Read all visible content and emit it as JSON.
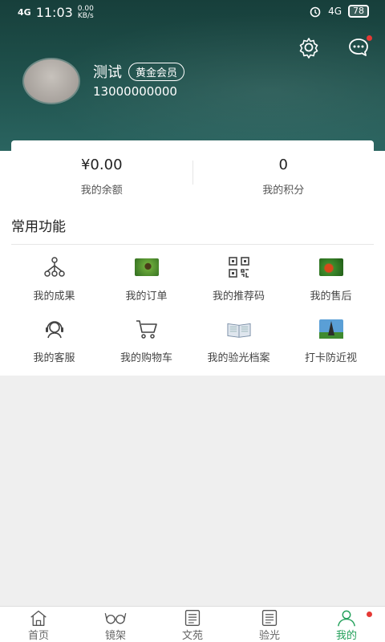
{
  "status_bar": {
    "signal": "4G",
    "time": "11:03",
    "speed_value": "0.00",
    "speed_unit": "KB/s",
    "alarm": "alarm",
    "network": "4G",
    "battery": "78"
  },
  "header": {
    "settings_icon": "gear-icon",
    "message_icon": "message-icon"
  },
  "profile": {
    "name": "测试",
    "badge": "黄金会员",
    "phone": "13000000000"
  },
  "stats": {
    "balance_value": "¥0.00",
    "balance_label": "我的余额",
    "points_value": "0",
    "points_label": "我的积分"
  },
  "functions": {
    "title": "常用功能",
    "items": [
      {
        "label": "我的成果",
        "icon": "network-tree-icon"
      },
      {
        "label": "我的订单",
        "icon": "order-thumbnail"
      },
      {
        "label": "我的推荐码",
        "icon": "qrcode-icon"
      },
      {
        "label": "我的售后",
        "icon": "aftersale-thumbnail"
      },
      {
        "label": "我的客服",
        "icon": "headset-icon"
      },
      {
        "label": "我的购物车",
        "icon": "cart-icon"
      },
      {
        "label": "我的验光档案",
        "icon": "book-thumbnail"
      },
      {
        "label": "打卡防近视",
        "icon": "tower-thumbnail"
      }
    ]
  },
  "tabbar": {
    "items": [
      {
        "label": "首页",
        "icon": "home-icon"
      },
      {
        "label": "镜架",
        "icon": "glasses-icon"
      },
      {
        "label": "文苑",
        "icon": "document-icon"
      },
      {
        "label": "验光",
        "icon": "document-icon"
      },
      {
        "label": "我的",
        "icon": "person-icon"
      }
    ],
    "active_color": "#22a05a"
  },
  "colors": {
    "header_bg": "#1e4f4a",
    "accent": "#22a05a",
    "notification_dot": "#e53935"
  }
}
